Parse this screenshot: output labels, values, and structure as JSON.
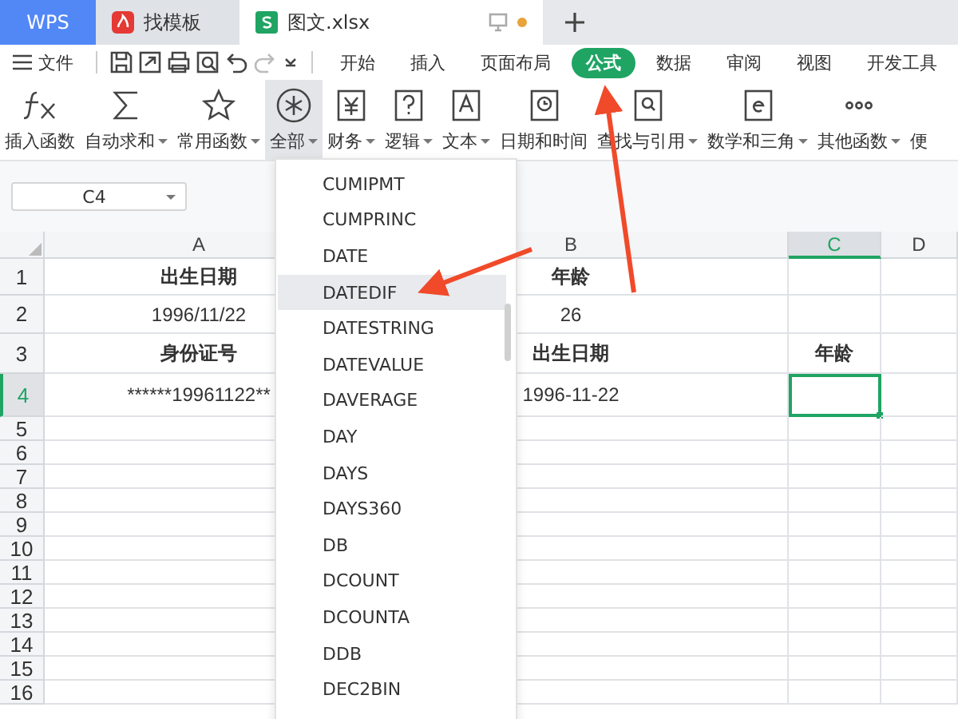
{
  "tabs": [
    {
      "label": "WPS",
      "kind": "brand",
      "selected": false,
      "modified": false
    },
    {
      "label": "找模板",
      "kind": "template",
      "selected": false,
      "modified": false
    },
    {
      "label": "图文.xlsx",
      "kind": "sheet",
      "selected": true,
      "modified": true
    }
  ],
  "menu": {
    "file": "文件",
    "tabs": [
      {
        "label": "开始",
        "selected": false
      },
      {
        "label": "插入",
        "selected": false
      },
      {
        "label": "页面布局",
        "selected": false
      },
      {
        "label": "公式",
        "selected": true
      },
      {
        "label": "数据",
        "selected": false
      },
      {
        "label": "审阅",
        "selected": false
      },
      {
        "label": "视图",
        "selected": false
      },
      {
        "label": "开发工具",
        "selected": false
      }
    ]
  },
  "ribbon": [
    {
      "label": "插入函数",
      "kind": "fx",
      "dropdown": false,
      "selected": false
    },
    {
      "label": "自动求和",
      "kind": "sum",
      "dropdown": true,
      "selected": false
    },
    {
      "label": "常用函数",
      "kind": "star",
      "dropdown": true,
      "selected": false
    },
    {
      "label": "全部",
      "kind": "all",
      "dropdown": true,
      "selected": true
    },
    {
      "label": "财务",
      "kind": "finance",
      "dropdown": true,
      "selected": false
    },
    {
      "label": "逻辑",
      "kind": "logic",
      "dropdown": true,
      "selected": false
    },
    {
      "label": "文本",
      "kind": "text",
      "dropdown": true,
      "selected": false
    },
    {
      "label": "日期和时间",
      "kind": "clock",
      "dropdown": false,
      "selected": false
    },
    {
      "label": "查找与引用",
      "kind": "lookup",
      "dropdown": true,
      "selected": false
    },
    {
      "label": "数学和三角",
      "kind": "math",
      "dropdown": true,
      "selected": false
    },
    {
      "label": "其他函数",
      "kind": "more",
      "dropdown": true,
      "selected": false
    },
    {
      "label": "便",
      "kind": "cut",
      "dropdown": false,
      "selected": false
    }
  ],
  "name_box": "C4",
  "columns": [
    {
      "label": "A",
      "selected": false
    },
    {
      "label": "B",
      "selected": false
    },
    {
      "label": "C",
      "selected": true
    },
    {
      "label": "D",
      "selected": false
    }
  ],
  "rows": [
    {
      "header": "1",
      "selected": false,
      "bold": true,
      "cells": [
        "出生日期",
        "年龄"
      ]
    },
    {
      "header": "2",
      "selected": false,
      "bold": false,
      "cells": [
        "1996/11/22",
        "26"
      ]
    },
    {
      "header": "3",
      "selected": false,
      "bold": true,
      "cells": [
        "身份证号",
        "出生日期",
        "年龄"
      ]
    },
    {
      "header": "4",
      "selected": true,
      "bold": false,
      "cells": [
        "******19961122**",
        "1996-11-22"
      ]
    },
    {
      "header": "5",
      "selected": false,
      "cells": []
    },
    {
      "header": "6",
      "selected": false,
      "cells": []
    },
    {
      "header": "7",
      "selected": false,
      "cells": []
    },
    {
      "header": "8",
      "selected": false,
      "cells": []
    },
    {
      "header": "9",
      "selected": false,
      "cells": []
    },
    {
      "header": "10",
      "selected": false,
      "cells": []
    },
    {
      "header": "11",
      "selected": false,
      "cells": []
    },
    {
      "header": "12",
      "selected": false,
      "cells": []
    },
    {
      "header": "13",
      "selected": false,
      "cells": []
    },
    {
      "header": "14",
      "selected": false,
      "cells": []
    },
    {
      "header": "15",
      "selected": false,
      "cells": []
    },
    {
      "header": "16",
      "selected": false,
      "cells": []
    }
  ],
  "function_menu": [
    {
      "label": "CUMIPMT",
      "selected": false
    },
    {
      "label": "CUMPRINC",
      "selected": false
    },
    {
      "label": "DATE",
      "selected": false
    },
    {
      "label": "DATEDIF",
      "selected": true
    },
    {
      "label": "DATESTRING",
      "selected": false
    },
    {
      "label": "DATEVALUE",
      "selected": false
    },
    {
      "label": "DAVERAGE",
      "selected": false
    },
    {
      "label": "DAY",
      "selected": false
    },
    {
      "label": "DAYS",
      "selected": false
    },
    {
      "label": "DAYS360",
      "selected": false
    },
    {
      "label": "DB",
      "selected": false
    },
    {
      "label": "DCOUNT",
      "selected": false
    },
    {
      "label": "DCOUNTA",
      "selected": false
    },
    {
      "label": "DDB",
      "selected": false
    },
    {
      "label": "DEC2BIN",
      "selected": false
    }
  ]
}
